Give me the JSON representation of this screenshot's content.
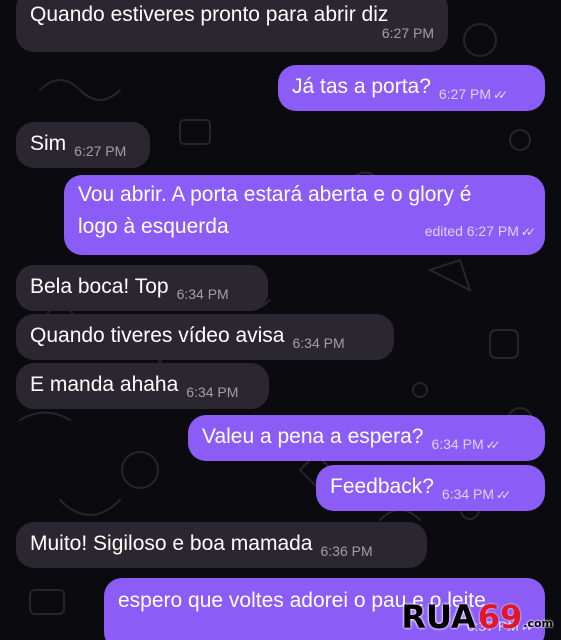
{
  "colors": {
    "background": "#0b0b0f",
    "incoming_bubble": "#2b2730",
    "outgoing_bubble": "#8b5cf6",
    "watermark_red": "#e0162b"
  },
  "messages": [
    {
      "direction": "incoming",
      "text": "Quando estiveres pronto para abrir diz",
      "time": "6:27 PM"
    },
    {
      "direction": "outgoing",
      "text": "Já tas a porta?",
      "time": "6:27 PM",
      "status": "read-double-check-icon"
    },
    {
      "direction": "incoming",
      "text": "Sim",
      "time": "6:27 PM"
    },
    {
      "direction": "outgoing",
      "line1": "Vou abrir. A porta estará aberta e o glory é",
      "line2": "logo à esquerda",
      "edited_time": "edited 6:27 PM",
      "status": "read-double-check-icon"
    },
    {
      "direction": "incoming",
      "text": "Bela boca! Top",
      "time": "6:34 PM"
    },
    {
      "direction": "incoming",
      "text": "Quando tiveres vídeo avisa",
      "time": "6:34 PM"
    },
    {
      "direction": "incoming",
      "text": "E manda ahaha",
      "time": "6:34 PM"
    },
    {
      "direction": "outgoing",
      "text": "Valeu a pena a espera?",
      "time": "6:34 PM",
      "status": "read-double-check-icon"
    },
    {
      "direction": "outgoing",
      "text": "Feedback?",
      "time": "6:34 PM",
      "status": "read-double-check-icon"
    },
    {
      "direction": "incoming",
      "text": "Muito! Sigiloso e boa mamada",
      "time": "6:36 PM"
    },
    {
      "direction": "outgoing",
      "text": "espero que voltes adorei o pau e o leite",
      "time": "6:37 PM",
      "status": "read-double-check-icon"
    }
  ],
  "ticks_glyph": "✓✓",
  "watermark": {
    "brand": "RUA",
    "number": "69",
    "suffix": ".com"
  }
}
